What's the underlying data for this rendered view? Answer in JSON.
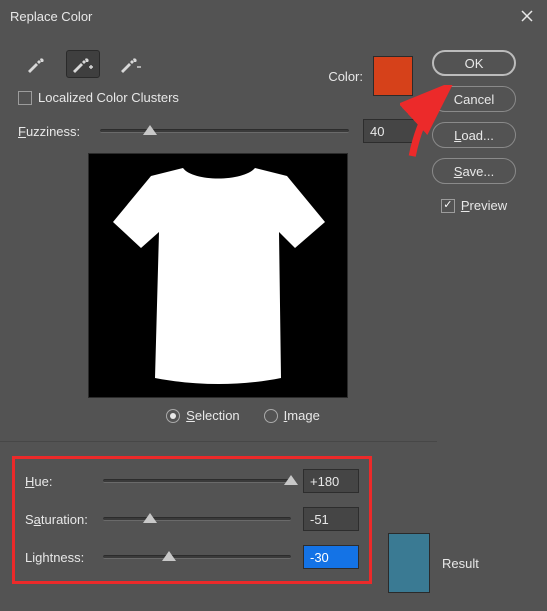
{
  "title": "Replace Color",
  "eyedroppers": {
    "active_index": 1
  },
  "localized_label": "Localized Color Clusters",
  "localized_checked": false,
  "fuzziness": {
    "label": "Fuzziness:",
    "value": "40",
    "pos_pct": 20
  },
  "color_label": "Color:",
  "color_swatch": "#d6411a",
  "radios": {
    "selection": "Selection",
    "image": "Image",
    "selected": "selection"
  },
  "buttons": {
    "ok": "OK",
    "cancel": "Cancel",
    "load": "Load...",
    "save": "Save..."
  },
  "preview": {
    "label": "Preview",
    "checked": true
  },
  "hsl": {
    "hue": {
      "label": "Hue:",
      "value": "+180",
      "pos_pct": 100
    },
    "saturation": {
      "label": "Saturation:",
      "value": "-51",
      "pos_pct": 25
    },
    "lightness": {
      "label": "Lightness:",
      "value": "-30",
      "pos_pct": 35
    }
  },
  "result": {
    "label": "Result",
    "swatch": "#3a7a93"
  }
}
